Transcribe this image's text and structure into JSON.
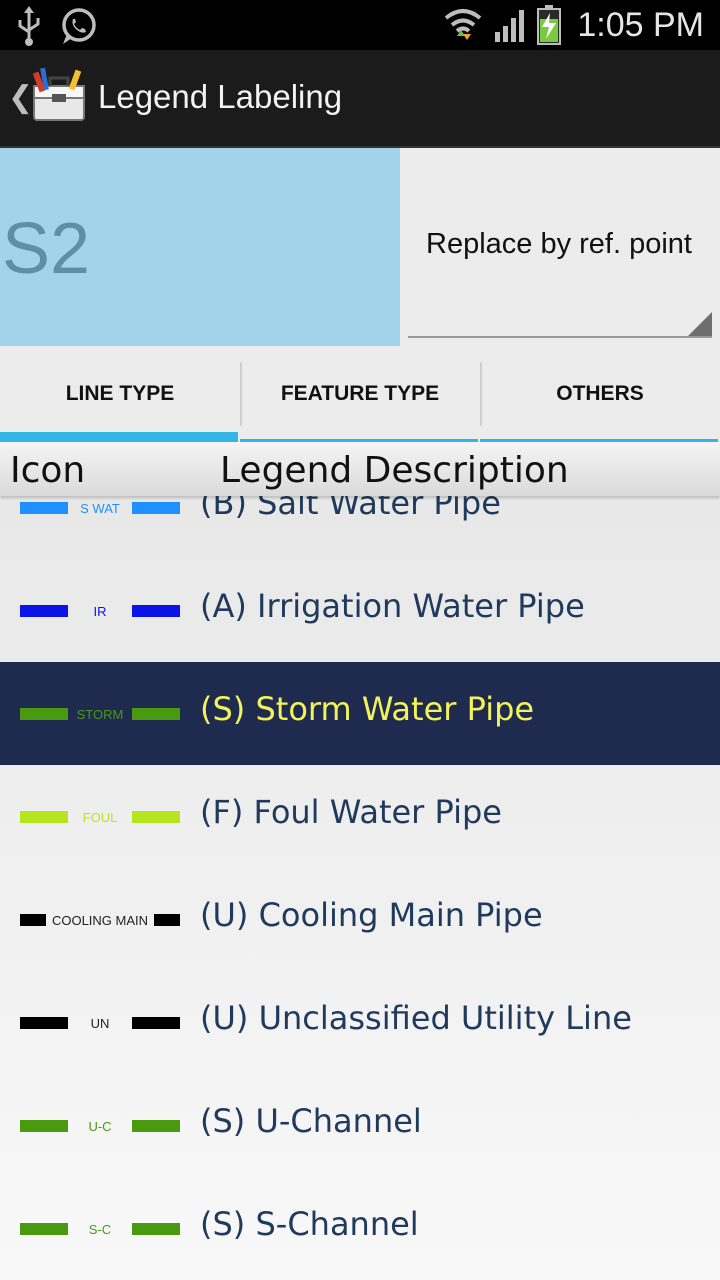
{
  "status_bar": {
    "time": "1:05 PM",
    "icons": [
      "usb-icon",
      "whatsapp-icon",
      "wifi-icon",
      "signal-icon",
      "battery-charging-icon"
    ]
  },
  "action_bar": {
    "back_icon": "chevron-left-icon",
    "app_icon": "toolbox-icon",
    "title": "Legend Labeling"
  },
  "point": {
    "id": "S2",
    "highlight_color": "#a3d3ea"
  },
  "replace_spinner": {
    "selected": "Replace by ref. point"
  },
  "tabs": [
    {
      "label": "LINE TYPE",
      "active": true
    },
    {
      "label": "FEATURE TYPE",
      "active": false
    },
    {
      "label": "OTHERS",
      "active": false
    }
  ],
  "list_header": {
    "icon": "Icon",
    "description": "Legend Description"
  },
  "legend_items": [
    {
      "code": "S WAT",
      "color": "#1e90ff",
      "label": "(B) Salt Water Pipe",
      "selected": false
    },
    {
      "code": "IR",
      "color": "#0a14e6",
      "label": "(A) Irrigation Water Pipe",
      "selected": false
    },
    {
      "code": "STORM",
      "color": "#4a9a10",
      "label": "(S) Storm Water Pipe",
      "selected": true
    },
    {
      "code": "FOUL",
      "color": "#b5e61d",
      "label": "(F) Foul Water Pipe",
      "selected": false
    },
    {
      "code": "COOLING MAIN",
      "color": "#000000",
      "label": "(U) Cooling Main Pipe",
      "selected": false
    },
    {
      "code": "UN",
      "color": "#000000",
      "label": "(U) Unclassified Utility Line",
      "selected": false
    },
    {
      "code": "U-C",
      "color": "#4a9a10",
      "label": "(S) U-Channel",
      "selected": false
    },
    {
      "code": "S-C",
      "color": "#4a9a10",
      "label": "(S) S-Channel",
      "selected": false
    }
  ],
  "colors": {
    "accent": "#33b5e5",
    "selected_row": "#1e2a4e",
    "selected_text": "#f2f25a",
    "row_text": "#1f3a5c"
  }
}
